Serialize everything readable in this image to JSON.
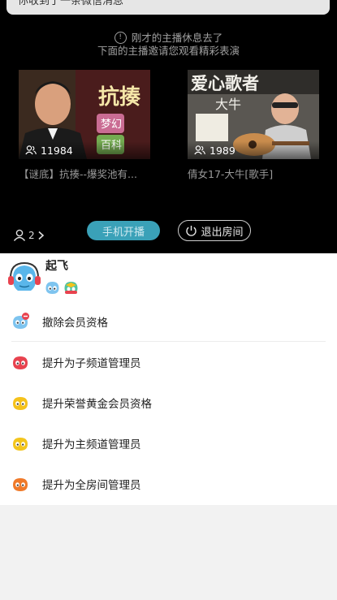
{
  "toast": {
    "text": "你收到了一条微信消息"
  },
  "notice": {
    "line1": "刚才的主播休息去了",
    "line2": "下面的主播邀请您观看精彩表演"
  },
  "cards": [
    {
      "viewers": "11984",
      "title": "【谜底】抗揍--爆奖池有...",
      "thumb_text": "抗揍",
      "thumb_sub1": "梦幻",
      "thumb_sub2": "百科"
    },
    {
      "viewers": "1989",
      "title": "倩女17-大牛[歌手]",
      "thumb_text": "爱心歌者",
      "thumb_sub1": "大牛"
    }
  ],
  "bottom_bar": {
    "user_count": "2",
    "start_label": "手机开播",
    "exit_label": "退出房间"
  },
  "profile": {
    "name": "起飞"
  },
  "menu": [
    {
      "label": "撤除会员资格",
      "icon": "blue-member-icon",
      "color": "#5aa9e6"
    },
    {
      "label": "提升为子频道管理员",
      "icon": "red-admin-icon",
      "color": "#e8434f"
    },
    {
      "label": "提升荣誉黄金会员资格",
      "icon": "gold-member-icon",
      "color": "#f5c21b"
    },
    {
      "label": "提升为主频道管理员",
      "icon": "yellow-admin-icon",
      "color": "#f3c51d"
    },
    {
      "label": "提升为全房间管理员",
      "icon": "orange-admin-icon",
      "color": "#f07a2a"
    }
  ]
}
